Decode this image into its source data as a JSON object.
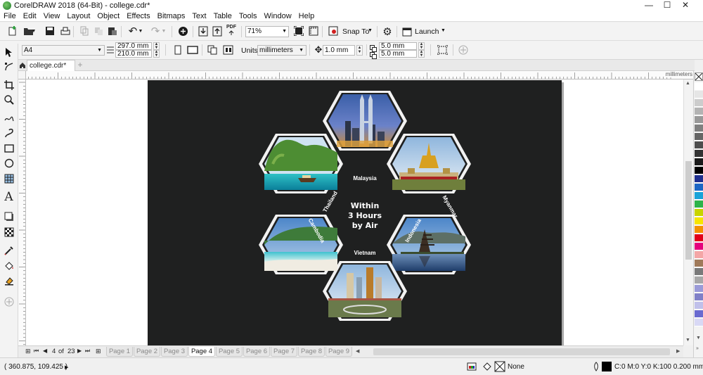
{
  "window": {
    "title": "CorelDRAW 2018 (64-Bit) - college.cdr*"
  },
  "menu": [
    "File",
    "Edit",
    "View",
    "Layout",
    "Object",
    "Effects",
    "Bitmaps",
    "Text",
    "Table",
    "Tools",
    "Window",
    "Help"
  ],
  "toolbar": {
    "zoom": "71%",
    "snap_to": "Snap To",
    "launch": "Launch"
  },
  "property_bar": {
    "paper_size": "A4",
    "width": "297.0 mm",
    "height": "210.0 mm",
    "units_label": "Units:",
    "units": "millimeters",
    "nudge": "1.0 mm",
    "dup_x": "5.0 mm",
    "dup_y": "5.0 mm"
  },
  "document_tab": {
    "name": "college.cdr*"
  },
  "ruler": {
    "unit": "millimeters"
  },
  "artwork": {
    "center_lines": [
      "Within",
      "3 Hours",
      "by Air"
    ],
    "countries": [
      "Malaysia",
      "Myanmar",
      "Indonesia",
      "Vietnam",
      "Cambodia",
      "Thailand"
    ]
  },
  "page_nav": {
    "current": "4",
    "of": "of",
    "total": "23"
  },
  "pages": [
    "Page 1",
    "Page 2",
    "Page 3",
    "Page 4",
    "Page 5",
    "Page 6",
    "Page 7",
    "Page 8",
    "Page 9"
  ],
  "active_page": "Page 4",
  "status": {
    "cursor": "( 360.875, 109.425 )",
    "fill": "None",
    "outline": "C:0 M:0 Y:0 K:100  0.200 mm"
  },
  "palette_colors": [
    "#ffffff",
    "#e6e6e6",
    "#cccccc",
    "#b3b3b3",
    "#999999",
    "#808080",
    "#666666",
    "#4d4d4d",
    "#333333",
    "#1a1a1a",
    "#000000",
    "#1f2f8f",
    "#1d66c4",
    "#1aa3d8",
    "#2db34a",
    "#c8d400",
    "#f7e500",
    "#f39200",
    "#e2001a",
    "#e5007d",
    "#f4a6a6",
    "#a07a5a",
    "#7a7a7a",
    "#a8a8a8",
    "#9b9bd8",
    "#8080c8",
    "#c0c0ea",
    "#6a6ad0",
    "#d8d8f5"
  ]
}
